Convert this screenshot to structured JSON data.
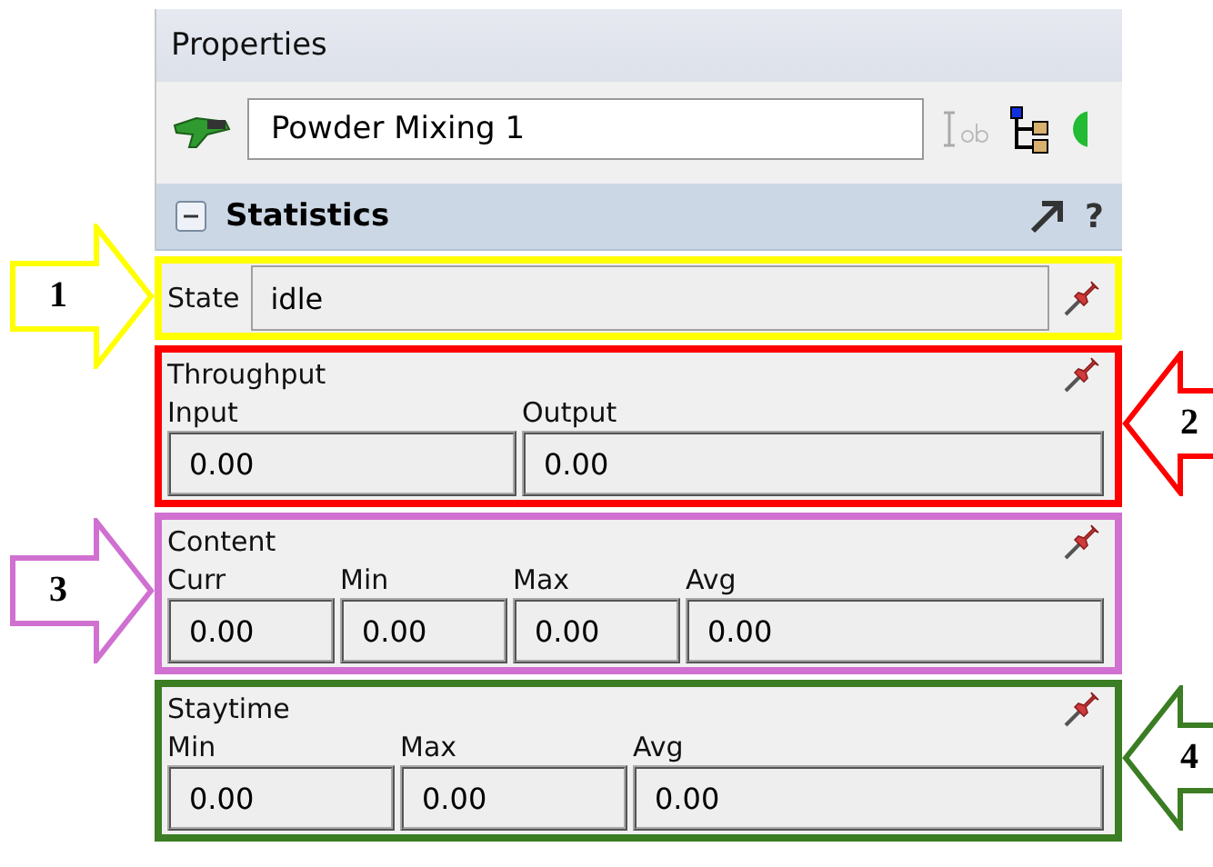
{
  "panel": {
    "title": "Properties",
    "object_name": "Powder Mixing 1"
  },
  "section": {
    "title": "Statistics",
    "expanded": true,
    "help": "?"
  },
  "groups": [
    {
      "kind": "state",
      "label": "State",
      "value": "idle",
      "color": "#ffff00",
      "callout": {
        "number": "1",
        "points_right": true
      }
    },
    {
      "kind": "stats",
      "title": "Throughput",
      "color": "#ff0000",
      "callout": {
        "number": "2",
        "points_right": false
      },
      "fields": [
        {
          "label": "Input",
          "value": "0.00"
        },
        {
          "label": "Output",
          "value": "0.00"
        }
      ]
    },
    {
      "kind": "stats",
      "title": "Content",
      "color": "#d070d0",
      "callout": {
        "number": "3",
        "points_right": true
      },
      "fields": [
        {
          "label": "Curr",
          "value": "0.00"
        },
        {
          "label": "Min",
          "value": "0.00"
        },
        {
          "label": "Max",
          "value": "0.00"
        },
        {
          "label": "Avg",
          "value": "0.00"
        }
      ]
    },
    {
      "kind": "stats",
      "title": "Staytime",
      "color": "#3a7d23",
      "callout": {
        "number": "4",
        "points_right": false
      },
      "fields": [
        {
          "label": "Min",
          "value": "0.00"
        },
        {
          "label": "Max",
          "value": "0.00"
        },
        {
          "label": "Avg",
          "value": "0.00"
        }
      ]
    }
  ]
}
